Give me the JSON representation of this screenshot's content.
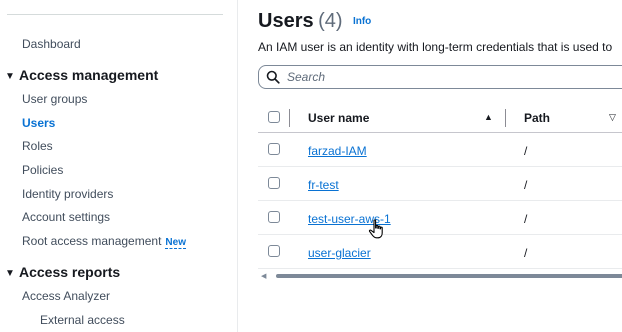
{
  "sidebar": {
    "dashboard": "Dashboard",
    "access_management": {
      "label": "Access management",
      "items": [
        "User groups",
        "Users",
        "Roles",
        "Policies",
        "Identity providers",
        "Account settings",
        "Root access management"
      ],
      "new_badge": "New"
    },
    "access_reports": {
      "label": "Access reports",
      "items": [
        "Access Analyzer"
      ],
      "sub_items": [
        "External access"
      ]
    },
    "active_item": "Users"
  },
  "main": {
    "title": "Users",
    "count": "(4)",
    "info": "Info",
    "description": "An IAM user is an identity with long-term credentials that is used to",
    "search": {
      "placeholder": "Search",
      "value": ""
    },
    "table": {
      "columns": [
        "User name",
        "Path"
      ],
      "rows": [
        {
          "user_name": "farzad-IAM",
          "path": "/"
        },
        {
          "user_name": "fr-test",
          "path": "/"
        },
        {
          "user_name": "test-user-aws-1",
          "path": "/"
        },
        {
          "user_name": "user-glacier",
          "path": "/"
        }
      ]
    }
  },
  "colors": {
    "link": "#0972d3",
    "text": "#16191f",
    "muted": "#5f6b7a"
  },
  "icons": [
    "search-icon",
    "caret-down-icon",
    "sort-ascending-icon",
    "sort-descending-icon",
    "hand-pointer-icon"
  ]
}
